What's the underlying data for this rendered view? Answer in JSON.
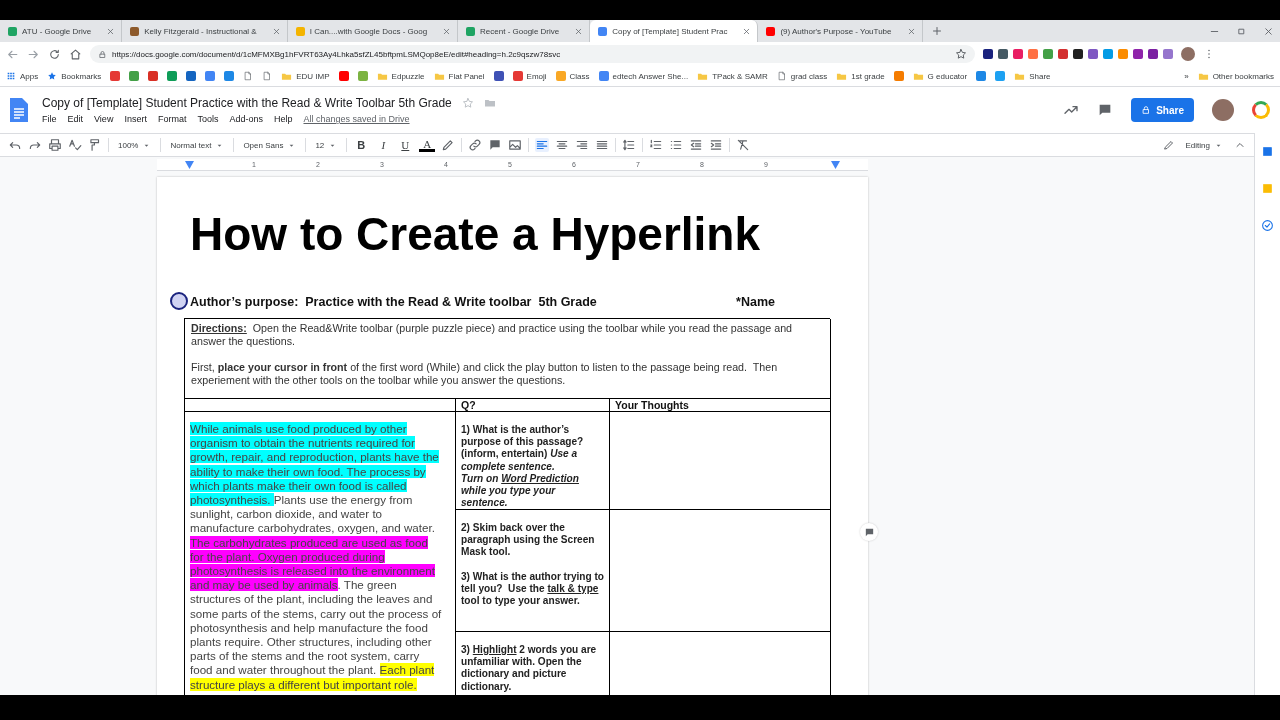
{
  "browser": {
    "tabs": [
      {
        "title": "ATU - Google Drive",
        "selected": false,
        "color": "#1fa463"
      },
      {
        "title": "Kelly Fitzgerald - Instructional &",
        "selected": false,
        "color": "#8d5a2b"
      },
      {
        "title": "I Can....with Google Docs - Goog",
        "selected": false,
        "color": "#f4b400"
      },
      {
        "title": "Recent - Google Drive",
        "selected": false,
        "color": "#1fa463"
      },
      {
        "title": "Copy of [Template] Student Prac",
        "selected": true,
        "color": "#4285f4"
      },
      {
        "title": "(9) Author's Purpose - YouTube",
        "selected": false,
        "color": "#ff0000"
      }
    ],
    "url": "https://docs.google.com/document/d/1cMFMXBg1hFVRT63Ay4Lhka5sfZL45bftpmLSMQop8eE/edit#heading=h.2c9qszw78svc",
    "extensions": [
      {
        "color": "#1a237e"
      },
      {
        "color": "#455a64"
      },
      {
        "color": "#e91e63"
      },
      {
        "color": "#ff7043"
      },
      {
        "color": "#43a047"
      },
      {
        "color": "#d32f2f"
      },
      {
        "color": "#212121"
      },
      {
        "color": "#7e57c2"
      },
      {
        "color": "#039be5"
      },
      {
        "color": "#fb8c00"
      },
      {
        "color": "#8e24aa"
      },
      {
        "color": "#7b1fa2"
      },
      {
        "color": "#9575cd"
      }
    ],
    "bookmarks": [
      {
        "kind": "apps",
        "label": "Apps"
      },
      {
        "kind": "star",
        "label": "Bookmarks"
      },
      {
        "kind": "site",
        "color": "#e53935"
      },
      {
        "kind": "site",
        "color": "#43a047"
      },
      {
        "kind": "site",
        "color": "#d93025"
      },
      {
        "kind": "site",
        "color": "#0f9d58"
      },
      {
        "kind": "site",
        "color": "#1565c0"
      },
      {
        "kind": "site",
        "color": "#4285f4"
      },
      {
        "kind": "site",
        "color": "#1e88e5"
      },
      {
        "kind": "page"
      },
      {
        "kind": "page"
      },
      {
        "kind": "folder",
        "label": "EDU IMP"
      },
      {
        "kind": "site",
        "color": "#ff0000"
      },
      {
        "kind": "site",
        "color": "#7cb342"
      },
      {
        "kind": "folder",
        "label": "Edpuzzle"
      },
      {
        "kind": "folder",
        "label": "Flat Panel"
      },
      {
        "kind": "site",
        "color": "#3f51b5"
      },
      {
        "kind": "site",
        "color": "#e53935",
        "label": "Emoji"
      },
      {
        "kind": "site",
        "color": "#f9a825",
        "label": "Class"
      },
      {
        "kind": "site",
        "color": "#4285f4",
        "label": "edtech Answer She..."
      },
      {
        "kind": "folder",
        "label": "TPack & SAMR"
      },
      {
        "kind": "page",
        "label": "grad class"
      },
      {
        "kind": "folder",
        "label": "1st grade"
      },
      {
        "kind": "site",
        "color": "#f57c00"
      },
      {
        "kind": "folder",
        "label": "G educator"
      },
      {
        "kind": "site",
        "color": "#1e88e5"
      },
      {
        "kind": "site",
        "color": "#1da1f2"
      },
      {
        "kind": "folder",
        "label": "Share"
      }
    ],
    "more_bookmarks": "»",
    "other_bookmarks": "Other bookmarks"
  },
  "docs": {
    "title": "Copy of [Template] Student Practice with the Read & Write Toolbar 5th Grade",
    "menu": [
      "File",
      "Edit",
      "View",
      "Insert",
      "Format",
      "Tools",
      "Add-ons",
      "Help"
    ],
    "save_status": "All changes saved in Drive",
    "share": "Share",
    "toolbar": {
      "zoom": "100%",
      "style": "Normal text",
      "font": "Open Sans",
      "size": "12",
      "format": [
        {
          "label": "B",
          "kind": "bold"
        },
        {
          "label": "I",
          "kind": "italic"
        },
        {
          "label": "U",
          "kind": "underline"
        },
        {
          "label": "A",
          "kind": "color"
        }
      ],
      "alignment": [
        {
          "selected": true
        },
        {
          "selected": false
        },
        {
          "selected": false
        },
        {
          "selected": false
        }
      ],
      "mode": "Editing"
    },
    "ruler": [
      "1",
      "2",
      "3",
      "4",
      "5",
      "6",
      "7",
      "8",
      "9"
    ]
  },
  "document": {
    "title": "How to Create a Hyperlink",
    "heading": "Author’s purpose:  Practice with the Read & Write toolbar  5th Grade",
    "name_label": "*Name",
    "directions": [
      {
        "text": "Directions:",
        "kind": "bold-underline"
      },
      {
        "text": "  Open the Read&Write toolbar (purple puzzle piece) and practice using the toolbar while you read the passage and answer the questions.",
        "kind": "plain"
      }
    ],
    "instructions": "First, **place your cursor in front** of the first word (While) and click the play button to listen to the passage being read.  Then experiement with the other tools on the toolbar while you answer the questions.",
    "table": {
      "columns": [
        "Q?",
        "Your Thoughts"
      ],
      "passage": [
        {
          "text": "While animals use food produced by other organism to obtain the nutrients required for growth, repair, and reproduction, plants have the ability to make their own food. The process by which plants make their own food is called photosynthesis. ",
          "color": "#00ffff"
        },
        {
          "text": "Plants use the energy from sunlight, carbon dioxide, and water to manufacture carbohydrates, oxygen, and water. "
        },
        {
          "text": "The carbohydrates produced are used as food for the plant. Oxygen produced during photosynthesis is released into the environment and may be used by animals",
          "color": "#ff00ff"
        },
        {
          "text": ". The green structures of the plant, including the leaves and some parts of the stems, carry out the process of photosynthesis and help manufacture the food plants require. Other structures, including other parts of the stems and the root system, carry food and water throughout the plant. "
        },
        {
          "text": "Each plant structure plays a different but important role.",
          "color": "#ffff00"
        }
      ],
      "questions": [
        {
          "blocks": [
            [
              [
                {
                  "text": "1) What is the author’s purpose of this passage? (inform, entertain) ",
                  "kind": "bold"
                },
                {
                  "text": "Use a complete sentence.",
                  "kind": "bold-italic"
                }
              ],
              [
                {
                  "text": "Turn on ",
                  "kind": "bold-italic"
                },
                {
                  "text": "Word Prediction",
                  "kind": "bold-italic-underline"
                },
                {
                  "text": " while you type your sentence.",
                  "kind": "bold-italic"
                }
              ]
            ]
          ]
        },
        {
          "blocks": [
            [
              [
                {
                  "text": "2) Skim back over the paragraph using the Screen Mask tool.",
                  "kind": "bold"
                }
              ]
            ],
            [
              [
                {
                  "text": "3) What is the author trying to tell you?  Use the ",
                  "kind": "bold"
                },
                {
                  "text": "talk & type",
                  "kind": "bold-underline"
                },
                {
                  "text": " tool to type your answer.",
                  "kind": "bold"
                }
              ]
            ]
          ]
        },
        {
          "blocks": [
            [
              [
                {
                  "text": "3) ",
                  "kind": "bold"
                },
                {
                  "text": "Highlight",
                  "kind": "bold-underline"
                },
                {
                  "text": " 2 words you are unfamiliar with. Open the dictionary and picture dictionary.",
                  "kind": "bold"
                }
              ]
            ]
          ]
        }
      ]
    }
  }
}
